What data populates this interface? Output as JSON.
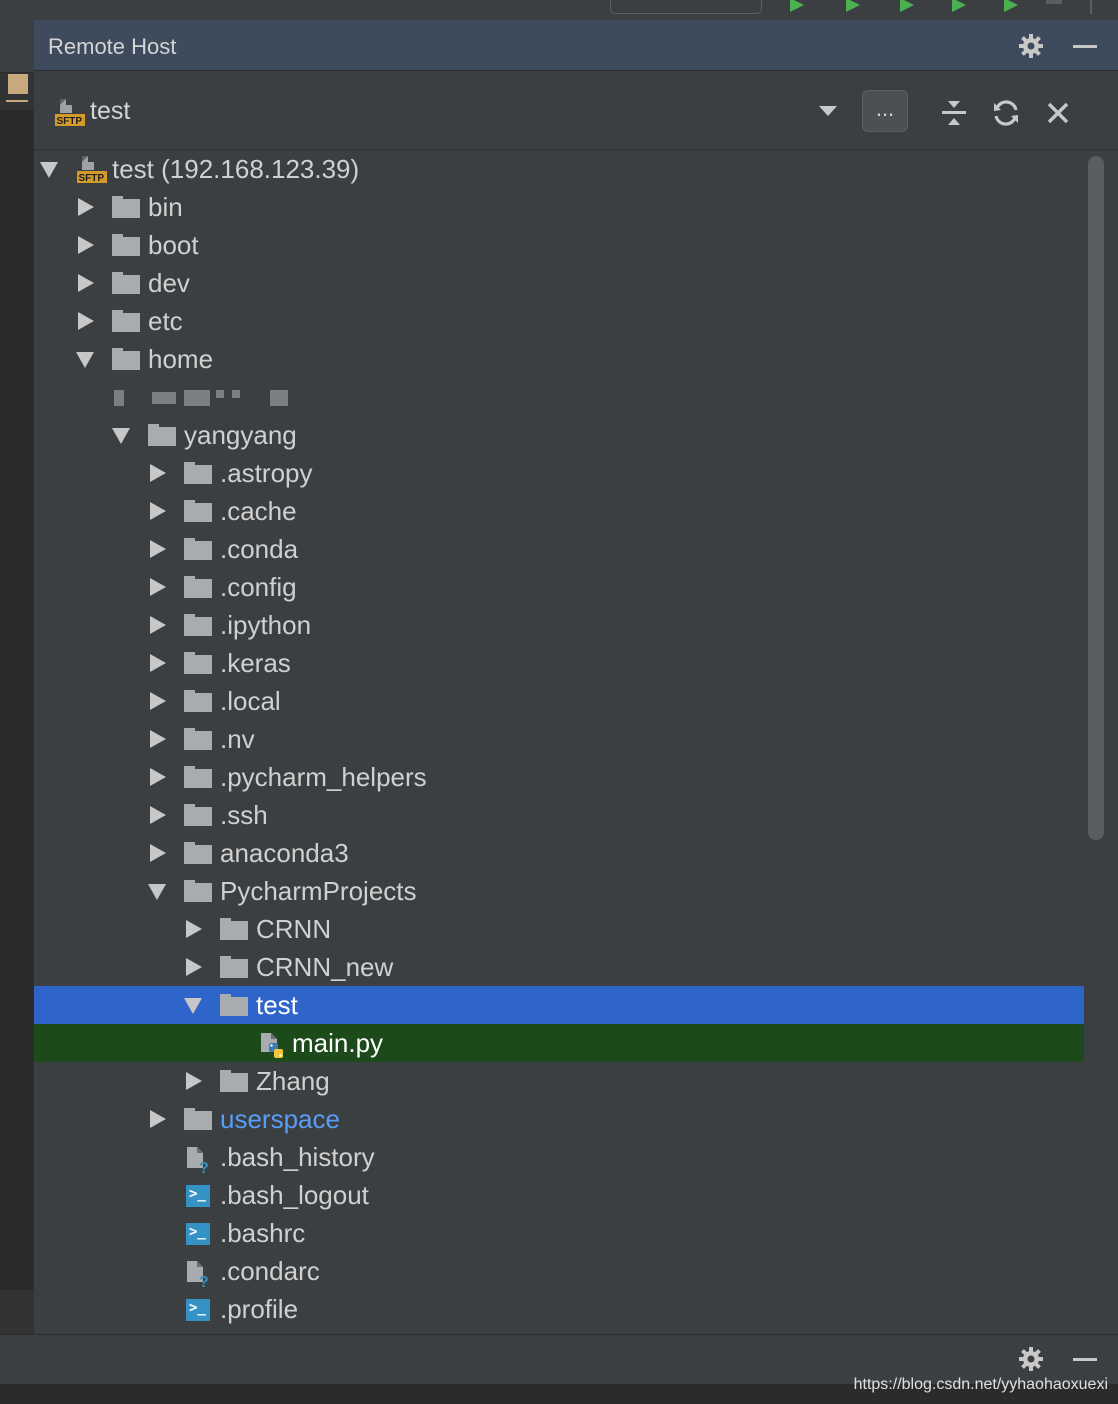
{
  "window": {
    "title": "Remote Host"
  },
  "colors": {
    "accent_selection": "#2f65ca",
    "file_selection": "#1d4a1b",
    "link_folder": "#589df6",
    "panel_bg": "#3c3f41",
    "title_bg": "#3d4b5c"
  },
  "toolbar": {
    "host": "test",
    "host_icon": "sftp-server-icon",
    "more_label": "...",
    "icons": [
      "dropdown-icon",
      "collapse-all-icon",
      "refresh-icon",
      "close-icon"
    ]
  },
  "tree": {
    "root": "test (192.168.123.39)",
    "nodes": [
      {
        "label": "bin",
        "kind": "folder",
        "depth": 1,
        "state": "collapsed"
      },
      {
        "label": "boot",
        "kind": "folder",
        "depth": 1,
        "state": "collapsed"
      },
      {
        "label": "dev",
        "kind": "folder",
        "depth": 1,
        "state": "collapsed"
      },
      {
        "label": "etc",
        "kind": "folder",
        "depth": 1,
        "state": "collapsed"
      },
      {
        "label": "home",
        "kind": "folder",
        "depth": 1,
        "state": "expanded"
      },
      {
        "label": "",
        "kind": "redacted",
        "depth": 2
      },
      {
        "label": "yangyang",
        "kind": "folder",
        "depth": 2,
        "state": "expanded"
      },
      {
        "label": ".astropy",
        "kind": "folder",
        "depth": 3,
        "state": "collapsed"
      },
      {
        "label": ".cache",
        "kind": "folder",
        "depth": 3,
        "state": "collapsed"
      },
      {
        "label": ".conda",
        "kind": "folder",
        "depth": 3,
        "state": "collapsed"
      },
      {
        "label": ".config",
        "kind": "folder",
        "depth": 3,
        "state": "collapsed"
      },
      {
        "label": ".ipython",
        "kind": "folder",
        "depth": 3,
        "state": "collapsed"
      },
      {
        "label": ".keras",
        "kind": "folder",
        "depth": 3,
        "state": "collapsed"
      },
      {
        "label": ".local",
        "kind": "folder",
        "depth": 3,
        "state": "collapsed"
      },
      {
        "label": ".nv",
        "kind": "folder",
        "depth": 3,
        "state": "collapsed"
      },
      {
        "label": ".pycharm_helpers",
        "kind": "folder",
        "depth": 3,
        "state": "collapsed"
      },
      {
        "label": ".ssh",
        "kind": "folder",
        "depth": 3,
        "state": "collapsed"
      },
      {
        "label": "anaconda3",
        "kind": "folder",
        "depth": 3,
        "state": "collapsed"
      },
      {
        "label": "PycharmProjects",
        "kind": "folder",
        "depth": 3,
        "state": "expanded"
      },
      {
        "label": "CRNN",
        "kind": "folder",
        "depth": 4,
        "state": "collapsed"
      },
      {
        "label": "CRNN_new",
        "kind": "folder",
        "depth": 4,
        "state": "collapsed"
      },
      {
        "label": "test",
        "kind": "folder",
        "depth": 4,
        "state": "expanded",
        "selected": true
      },
      {
        "label": "main.py",
        "kind": "python-file",
        "depth": 5,
        "highlighted": true
      },
      {
        "label": "Zhang",
        "kind": "folder",
        "depth": 4,
        "state": "collapsed"
      },
      {
        "label": "userspace",
        "kind": "folder",
        "depth": 3,
        "state": "collapsed",
        "style": "link"
      },
      {
        "label": ".bash_history",
        "kind": "unknown-file",
        "depth": 3
      },
      {
        "label": ".bash_logout",
        "kind": "shell-file",
        "depth": 3
      },
      {
        "label": ".bashrc",
        "kind": "shell-file",
        "depth": 3
      },
      {
        "label": ".condarc",
        "kind": "unknown-file",
        "depth": 3
      },
      {
        "label": ".profile",
        "kind": "shell-file",
        "depth": 3
      }
    ]
  },
  "watermark": "https://blog.csdn.net/yyhaohaoxuexi"
}
